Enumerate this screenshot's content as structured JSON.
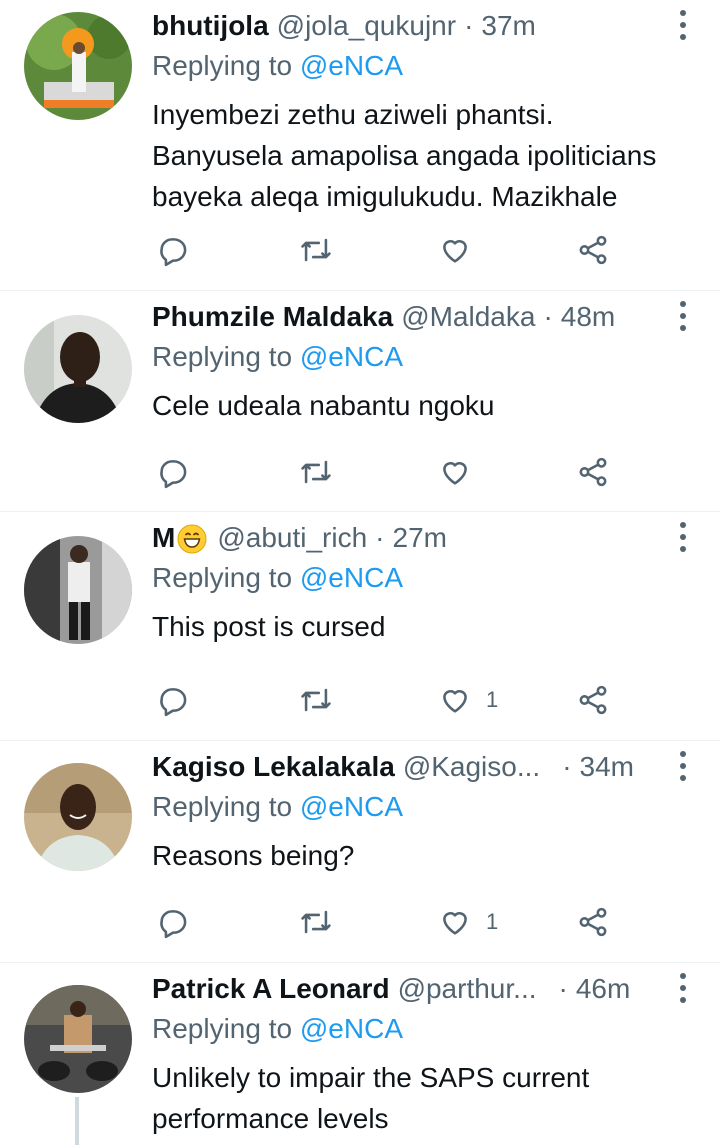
{
  "tweets": [
    {
      "name": "bhutijola",
      "handle": "@jola_qukujnr",
      "time": "37m",
      "replying_prefix": "Replying to",
      "replying_to": "@eNCA",
      "text_lines": [
        "Inyembezi zethu aziweli phantsi.",
        "Banyusela amapolisa angada ipoliticians",
        "bayeka aleqa imigulukudu. Mazikhale"
      ],
      "like_count": ""
    },
    {
      "name": "Phumzile Maldaka",
      "handle": "@Maldaka",
      "time": "48m",
      "replying_prefix": "Replying to",
      "replying_to": "@eNCA",
      "text_lines": [
        "Cele udeala nabantu ngoku"
      ],
      "like_count": ""
    },
    {
      "name": "M",
      "name_emoji": "grinning-face-emoji",
      "handle": "@abuti_rich",
      "time": "27m",
      "replying_prefix": "Replying to",
      "replying_to": "@eNCA",
      "text_lines": [
        "This post is cursed"
      ],
      "like_count": "1"
    },
    {
      "name": "Kagiso Lekalakala",
      "handle": "@Kagiso...",
      "time": "34m",
      "replying_prefix": "Replying to",
      "replying_to": "@eNCA",
      "text_lines": [
        "Reasons being?"
      ],
      "like_count": "1"
    },
    {
      "name": "Patrick A Leonard",
      "handle": "@parthur...",
      "time": "46m",
      "replying_prefix": "Replying to",
      "replying_to": "@eNCA",
      "text_lines": [
        "Unlikely to impair the SAPS current",
        "performance levels"
      ],
      "like_count": ""
    }
  ],
  "icons": {
    "reply": "reply-icon",
    "retweet": "retweet-icon",
    "like": "heart-icon",
    "share": "share-icon",
    "more": "more-vertical-icon"
  },
  "colors": {
    "text": "#0f1419",
    "secondary": "#536471",
    "link": "#1d9bf0",
    "divider": "#eff3f4"
  }
}
